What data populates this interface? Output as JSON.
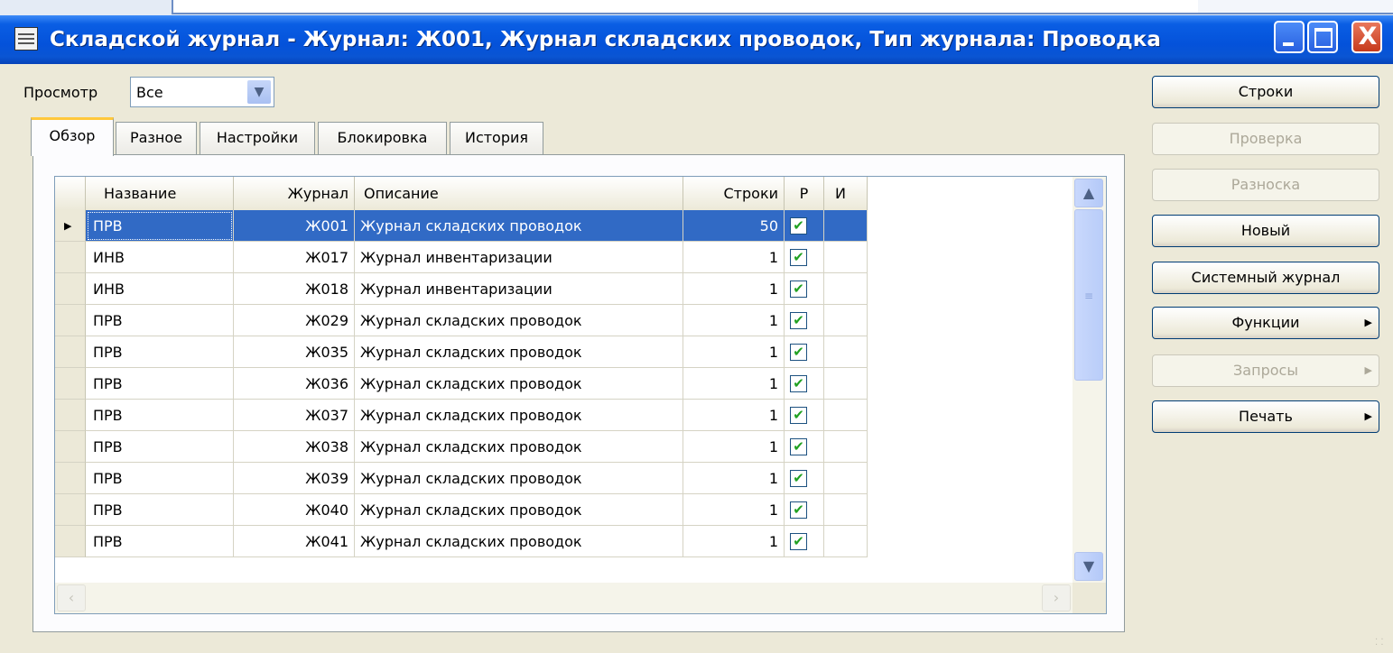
{
  "window": {
    "title": "Складской журнал - Журнал: Ж001, Журнал складских проводок, Тип журнала: Проводка",
    "controls": {
      "close": "X"
    }
  },
  "view": {
    "label": "Просмотр",
    "value": "Все"
  },
  "tabs": [
    {
      "label": "Обзор",
      "active": true
    },
    {
      "label": "Разное",
      "active": false
    },
    {
      "label": "Настройки",
      "active": false
    },
    {
      "label": "Блокировка",
      "active": false
    },
    {
      "label": "История",
      "active": false
    }
  ],
  "grid": {
    "columns": [
      "Название",
      "Журнал",
      "Описание",
      "Строки",
      "Р",
      "И"
    ],
    "rows": [
      {
        "name": "ПРВ",
        "journal": "Ж001",
        "description": "Журнал складских проводок",
        "lines": "50",
        "posted": true,
        "selected": true
      },
      {
        "name": "ИНВ",
        "journal": "Ж017",
        "description": "Журнал инвентаризации",
        "lines": "1",
        "posted": true
      },
      {
        "name": "ИНВ",
        "journal": "Ж018",
        "description": "Журнал инвентаризации",
        "lines": "1",
        "posted": true
      },
      {
        "name": "ПРВ",
        "journal": "Ж029",
        "description": "Журнал складских проводок",
        "lines": "1",
        "posted": true
      },
      {
        "name": "ПРВ",
        "journal": "Ж035",
        "description": "Журнал складских проводок",
        "lines": "1",
        "posted": true
      },
      {
        "name": "ПРВ",
        "journal": "Ж036",
        "description": "Журнал складских проводок",
        "lines": "1",
        "posted": true
      },
      {
        "name": "ПРВ",
        "journal": "Ж037",
        "description": "Журнал складских проводок",
        "lines": "1",
        "posted": true
      },
      {
        "name": "ПРВ",
        "journal": "Ж038",
        "description": "Журнал складских проводок",
        "lines": "1",
        "posted": true
      },
      {
        "name": "ПРВ",
        "journal": "Ж039",
        "description": "Журнал складских проводок",
        "lines": "1",
        "posted": true
      },
      {
        "name": "ПРВ",
        "journal": "Ж040",
        "description": "Журнал складских проводок",
        "lines": "1",
        "posted": true
      },
      {
        "name": "ПРВ",
        "journal": "Ж041",
        "description": "Журнал складских проводок",
        "lines": "1",
        "posted": true
      }
    ]
  },
  "buttons": [
    {
      "label": "Строки",
      "enabled": true
    },
    {
      "label": "Проверка",
      "enabled": false
    },
    {
      "label": "Разноска",
      "enabled": false
    },
    {
      "label": "Новый",
      "enabled": true
    },
    {
      "label": "Системный журнал",
      "enabled": true
    },
    {
      "label": "Функции",
      "enabled": true,
      "submenu": true
    },
    {
      "label": "Запросы",
      "enabled": false,
      "submenu": true
    },
    {
      "label": "Печать",
      "enabled": true,
      "submenu": true
    }
  ],
  "colors": {
    "titlebar": "#0452da",
    "selection": "#316ac5",
    "face": "#ece9d8",
    "checkmark": "#21a121"
  }
}
